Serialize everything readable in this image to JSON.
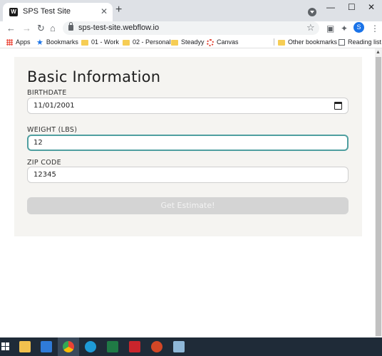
{
  "browser": {
    "tab_title": "SPS Test Site",
    "favicon_letter": "W",
    "url": "sps-test-site.webflow.io",
    "profile_initial": "S",
    "bookmarks": [
      {
        "label": "Apps",
        "icon": "apps-grid-icon"
      },
      {
        "label": "Bookmarks",
        "icon": "star-icon"
      },
      {
        "label": "01 - Work",
        "icon": "folder-icon"
      },
      {
        "label": "02 - Personal",
        "icon": "folder-icon"
      },
      {
        "label": "Steadyy",
        "icon": "folder-icon"
      },
      {
        "label": "Canvas",
        "icon": "canvas-icon"
      }
    ],
    "other_bookmarks": "Other bookmarks",
    "reading_list": "Reading list"
  },
  "form": {
    "title": "Basic Information",
    "birthdate": {
      "label": "BIRTHDATE",
      "value": "11/01/2001"
    },
    "weight": {
      "label": "WEIGHT (LBS)",
      "value": "12"
    },
    "zip": {
      "label": "ZIP CODE",
      "value": "12345"
    },
    "submit_label": "Get Estimate!"
  },
  "colors": {
    "card_bg": "#f5f4f1",
    "focus_border": "#4f9fa0",
    "button_disabled": "#d4d4d4",
    "taskbar": "#1f2b38"
  },
  "taskbar_icons": [
    "file-explorer-icon",
    "mail-icon",
    "chrome-icon",
    "edge-icon",
    "excel-icon",
    "acrobat-icon",
    "powerpoint-icon",
    "notes-icon"
  ]
}
